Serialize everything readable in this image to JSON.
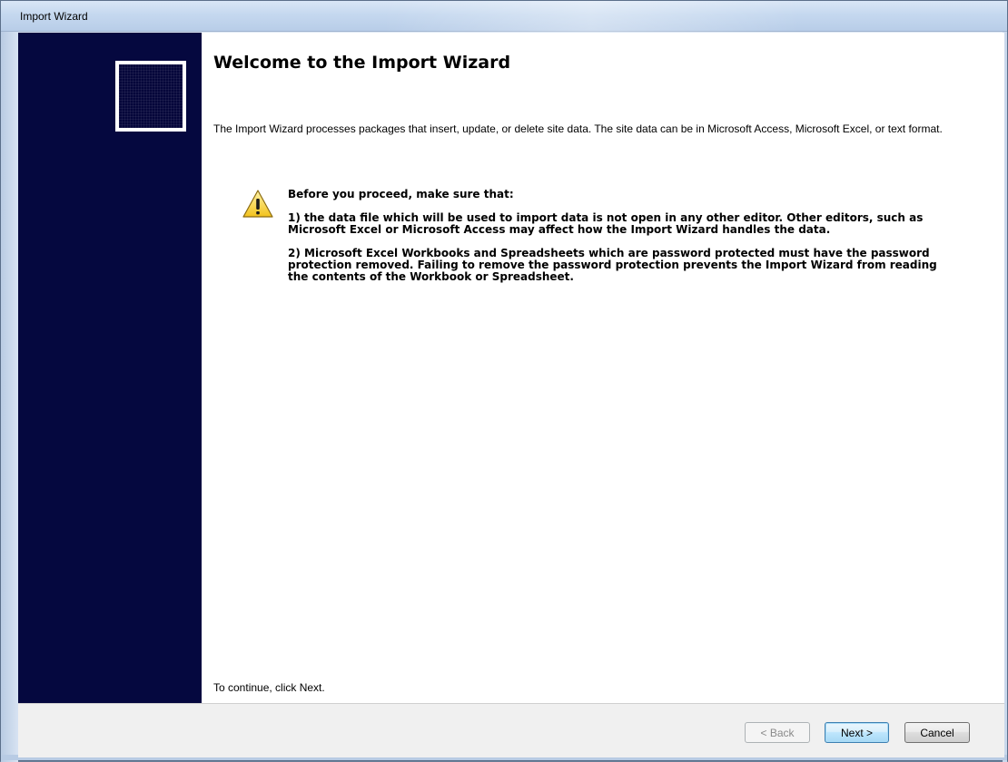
{
  "window": {
    "title": "Import Wizard"
  },
  "page": {
    "heading": "Welcome to the Import Wizard",
    "intro": "The Import Wizard processes packages that insert, update, or delete site data. The site data can be in Microsoft Access, Microsoft Excel, or text format.",
    "warning": {
      "icon": "warning-icon",
      "title": "Before you proceed, make sure that:",
      "item1": "1) the data file which will be used to import data is not open in any other editor. Other editors, such as Microsoft Excel or Microsoft Access may affect how the Import Wizard handles the data.",
      "item2": "2) Microsoft Excel Workbooks and Spreadsheets which are password protected must have the password protection removed. Failing to remove the password protection prevents the Import Wizard from reading the contents of the Workbook or Spreadsheet."
    },
    "continue_hint": "To continue, click Next."
  },
  "buttons": {
    "back": "< Back",
    "next": "Next >",
    "cancel": "Cancel"
  },
  "colors": {
    "side_panel": "#05083f",
    "title_bar": "#c5d8ef",
    "warning_yellow": "#f7d23e"
  }
}
